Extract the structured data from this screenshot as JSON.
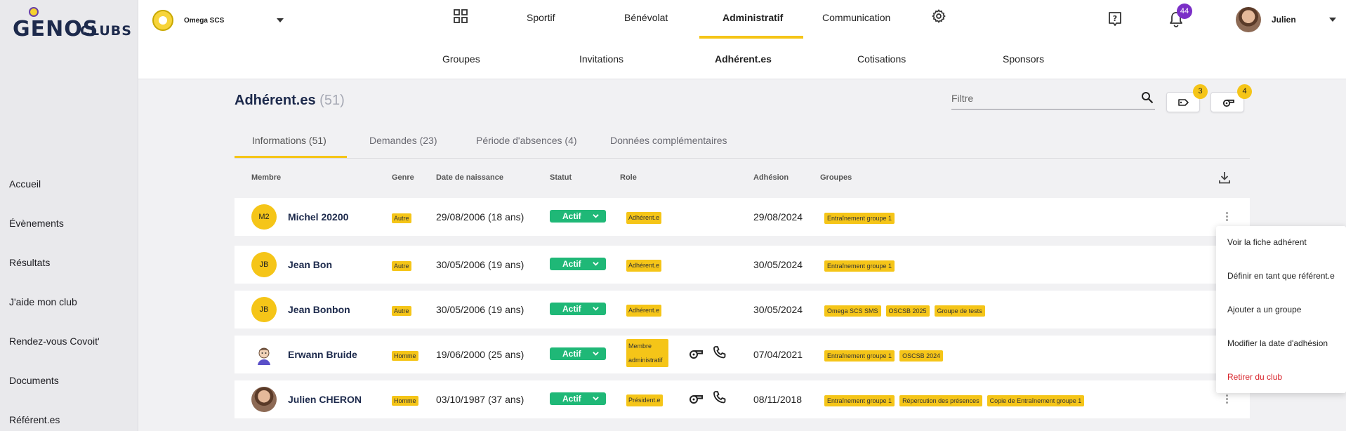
{
  "app": {
    "brand": "GENOS",
    "brand_sub": "CLUBS"
  },
  "club": {
    "name": "Omega SCS"
  },
  "sidebar": {
    "items": [
      {
        "label": "Accueil"
      },
      {
        "label": "Évènements"
      },
      {
        "label": "Résultats"
      },
      {
        "label": "J'aide mon club"
      },
      {
        "label": "Rendez-vous Covoit'"
      },
      {
        "label": "Documents"
      },
      {
        "label": "Référent.es"
      }
    ]
  },
  "header": {
    "nav": [
      {
        "label": "Sportif"
      },
      {
        "label": "Bénévolat"
      },
      {
        "label": "Administratif",
        "active": true
      },
      {
        "label": "Communication"
      }
    ],
    "notifications_count": "44",
    "user_name": "Julien",
    "subnav": [
      {
        "label": "Groupes"
      },
      {
        "label": "Invitations"
      },
      {
        "label": "Adhérent.es",
        "active": true
      },
      {
        "label": "Cotisations"
      },
      {
        "label": "Sponsors"
      }
    ]
  },
  "page": {
    "title": "Adhérent.es",
    "count": "(51)",
    "filter_placeholder": "Filtre",
    "tool_badges": [
      "3",
      "4"
    ]
  },
  "tabs": [
    {
      "label": "Informations (51)",
      "active": true
    },
    {
      "label": "Demandes (23)"
    },
    {
      "label": "Période d'absences (4)"
    },
    {
      "label": "Données complémentaires"
    }
  ],
  "table": {
    "columns": [
      "Membre",
      "Genre",
      "Date de naissance",
      "Statut",
      "Role",
      "Adhésion",
      "Groupes"
    ],
    "rows": [
      {
        "initials": "M2",
        "name": "Michel 20200",
        "genre": "Autre",
        "dob": "29/08/2006 (18 ans)",
        "statut": "Actif",
        "role": "Adhérent.e",
        "adhesion": "29/08/2024",
        "groups": [
          "Entraînement groupe 1"
        ]
      },
      {
        "initials": "JB",
        "name": "Jean Bon",
        "genre": "Autre",
        "dob": "30/05/2006 (19 ans)",
        "statut": "Actif",
        "role": "Adhérent.e",
        "adhesion": "30/05/2024",
        "groups": [
          "Entraînement groupe 1"
        ]
      },
      {
        "initials": "JB",
        "name": "Jean Bonbon",
        "genre": "Autre",
        "dob": "30/05/2006 (19 ans)",
        "statut": "Actif",
        "role": "Adhérent.e",
        "adhesion": "30/05/2024",
        "groups": [
          "Omega SCS SMS",
          "OSCSB 2025",
          "Groupe de tests"
        ]
      },
      {
        "initials": "",
        "name": "Erwann Bruide",
        "genre": "Homme",
        "dob": "19/06/2000 (25 ans)",
        "statut": "Actif",
        "role_line1": "Membre",
        "role_line2": "administratif",
        "adhesion": "07/04/2021",
        "groups": [
          "Entraînement groupe 1",
          "OSCSB 2024"
        ]
      },
      {
        "initials": "",
        "name": "Julien CHERON",
        "genre": "Homme",
        "dob": "03/10/1987 (37 ans)",
        "statut": "Actif",
        "role": "Président.e",
        "adhesion": "08/11/2018",
        "groups": [
          "Entraînement groupe 1",
          "Répercution des présences",
          "Copie de Entraînement groupe 1"
        ]
      }
    ]
  },
  "context_menu": {
    "items": [
      {
        "label": "Voir la fiche adhérent"
      },
      {
        "label": "Définir en tant que référent.e"
      },
      {
        "label": "Ajouter a un groupe"
      },
      {
        "label": "Modifier la date d'adhésion"
      },
      {
        "label": "Retirer du club",
        "danger": true
      }
    ]
  },
  "colors": {
    "accent": "#f5c518",
    "active_status": "#1fb877",
    "brand": "#1d2a4c",
    "notification": "#7b2fc7",
    "danger": "#d8232a"
  }
}
